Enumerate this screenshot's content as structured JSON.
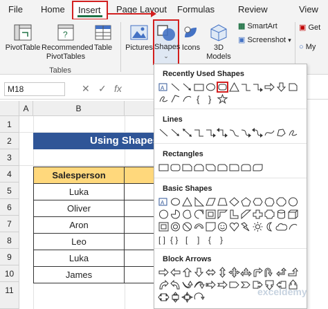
{
  "menu": {
    "tabs": [
      "File",
      "Home",
      "Insert",
      "Page Layout",
      "Formulas",
      "Review",
      "View"
    ]
  },
  "ribbon": {
    "pivottable": "PivotTable",
    "recommended": "Recommended",
    "recommended2": "PivotTables",
    "table": "Table",
    "tables_group": "Tables",
    "pictures": "Pictures",
    "shapes": "Shapes",
    "icons": "Icons",
    "models": "3D",
    "models2": "Models",
    "smartart": "SmartArt",
    "screenshot": "Screenshot",
    "get": "Get",
    "my": "My"
  },
  "formula_bar": {
    "namebox": "M18",
    "fx": "fx"
  },
  "grid": {
    "columns": [
      "A",
      "B"
    ],
    "rows": [
      "1",
      "2",
      "3",
      "4",
      "5",
      "6",
      "7",
      "8",
      "9",
      "10",
      "11"
    ],
    "title": "Using Shapes",
    "table_header": "Salesperson",
    "names": [
      "Luka",
      "Oliver",
      "Aron",
      "Leo",
      "Luka",
      "James"
    ]
  },
  "dropdown": {
    "recently_used": "Recently Used Shapes",
    "lines": "Lines",
    "rectangles": "Rectangles",
    "basic": "Basic Shapes",
    "block_arrows": "Block Arrows"
  },
  "colors": {
    "accent_red": "#d21f1f",
    "title_band": "#2f5597",
    "header_fill": "#ffd87c",
    "excel_green": "#1e7145"
  },
  "watermark": "exceldemy"
}
